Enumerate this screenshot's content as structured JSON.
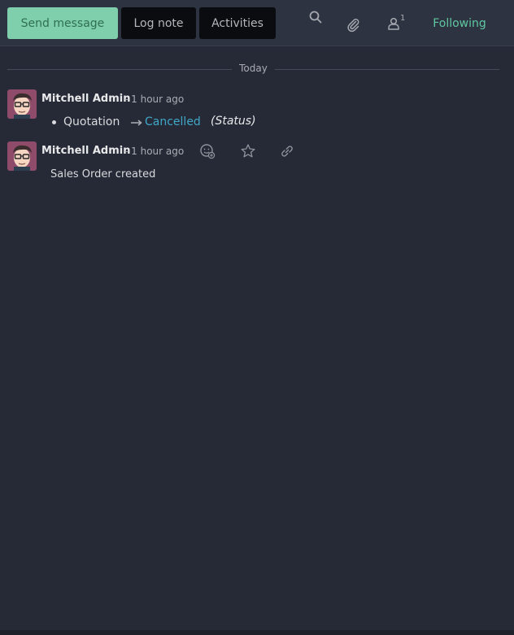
{
  "toolbar": {
    "send_message": "Send message",
    "log_note": "Log note",
    "activities": "Activities",
    "follower_count": "1",
    "following": "Following",
    "icons": [
      "search-icon",
      "paperclip-icon",
      "user-icon"
    ]
  },
  "separator": {
    "label": "Today"
  },
  "messages": [
    {
      "author": "Mitchell Admin",
      "meta": "- 1 hour ago",
      "tracking": {
        "field": "Quotation",
        "new_value": "Cancelled",
        "field_label": "(Status)"
      }
    },
    {
      "author": "Mitchell Admin",
      "meta": "- 1 hour ago",
      "body": "Sales Order created",
      "action_icons": [
        "add-reaction-icon",
        "star-icon",
        "link-icon"
      ]
    }
  ],
  "colors": {
    "background": "#262A36",
    "topbar": "#2E3342",
    "primary_button": "#7FCFAC",
    "following": "#5FC8A0",
    "tracking_value": "#3FA7C8"
  }
}
